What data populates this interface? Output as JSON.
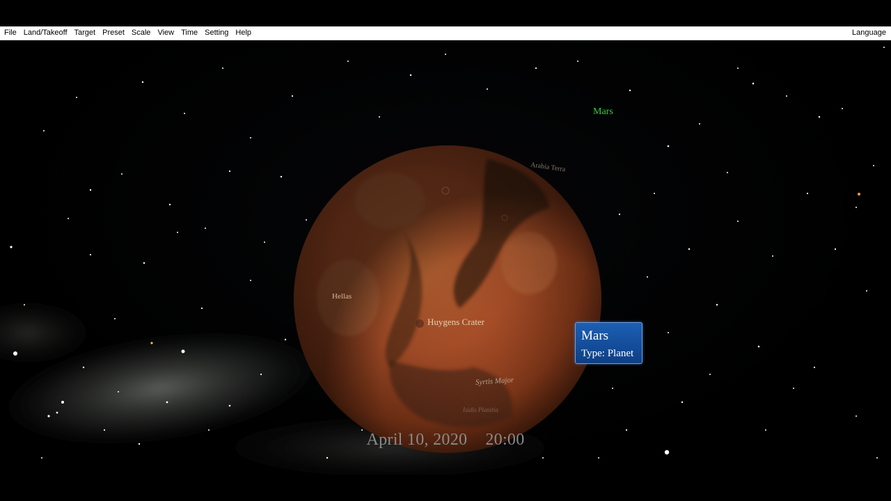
{
  "menubar": {
    "items": [
      {
        "label": "File"
      },
      {
        "label": "Land/Takeoff"
      },
      {
        "label": "Target"
      },
      {
        "label": "Preset"
      },
      {
        "label": "Scale"
      },
      {
        "label": "View"
      },
      {
        "label": "Time"
      },
      {
        "label": "Setting"
      },
      {
        "label": "Help"
      }
    ],
    "language_label": "Language"
  },
  "scene": {
    "planet_label": "Mars",
    "features": {
      "huygens": "Huygens Crater",
      "hellas": "Hellas",
      "syrtis": "Syrtis Major",
      "arabia": "Arabia Terra",
      "bottom": "Isidis Planitia"
    },
    "colors": {
      "planet_label": "#2fcf3a",
      "panel": "#1c5fb3",
      "mars_base": "#b5562a"
    }
  },
  "info_panel": {
    "title": "Mars",
    "type": "Type: Planet"
  },
  "status": {
    "date": "April 10, 2020",
    "time": "20:00"
  }
}
